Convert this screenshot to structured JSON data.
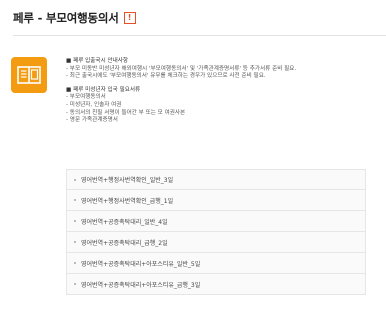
{
  "page": {
    "title": "페루 - 부모여행동의서",
    "info_icon": "!",
    "accent_color": "#e8502a",
    "icon_color": "#f39c12"
  },
  "notice": {
    "heading1": "■ 페루 입출국시 안내사항",
    "line1": "- 부모 미동반 미성년자 해외여행시 '부모여행동의서' 및 '가족관계증명서류' 등 추가서류 준비 필요.",
    "line2": "- 최근 출국시에도 '부모여행동의서' 유무를 체크하는 경우가 있으므로 사전 준비 필요.",
    "heading2": "■ 페루 미성년자 입국 필요서류",
    "items": [
      "- 부모여행동의서",
      "- 미성년자, 인솔자 여권",
      "- 동의서의 친필 서명이 들어간 부 또는 모 여권사본",
      "- 영문 가족관계증명서"
    ]
  },
  "services": [
    "영어번역+행정사번역확인_일반_3일",
    "영어번역+행정사번역확인_급행_1일",
    "영어번역+공증촉탁대리_일반_4일",
    "영어번역+공증촉탁대리_급행_2일",
    "영어번역+공증촉탁대리+아포스티유_일반_5일",
    "영어번역+공증촉탁대리+아포스티유_급행_3일"
  ]
}
